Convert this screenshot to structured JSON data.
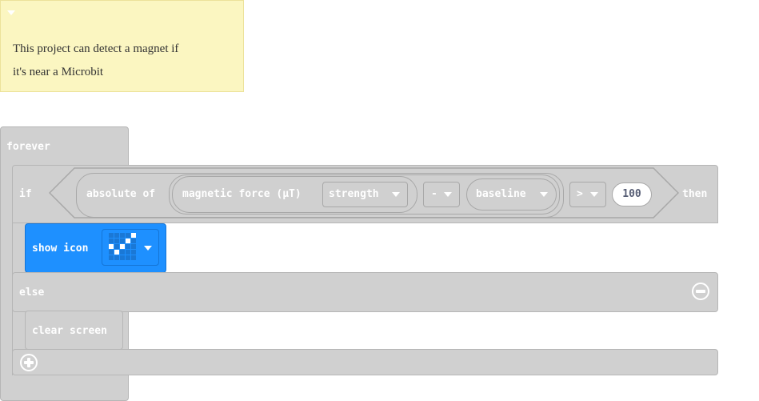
{
  "comment": {
    "lines": [
      "This project can detect a magnet if",
      "it's near a Microbit"
    ]
  },
  "blocks": {
    "forever": "forever",
    "if": "if",
    "then": "then",
    "else": "else",
    "absolute_of": "absolute of",
    "magnetic_force": "magnetic force (µT)",
    "axis_dropdown": "strength",
    "operator_dropdown": "-",
    "variable_dropdown": "baseline",
    "compare_dropdown": ">",
    "threshold_value": "100",
    "show_icon": "show icon",
    "clear_screen": "clear screen"
  },
  "icon_leds": [
    [
      0,
      0,
      0,
      0,
      1
    ],
    [
      0,
      0,
      0,
      1,
      0
    ],
    [
      1,
      0,
      1,
      0,
      0
    ],
    [
      0,
      1,
      0,
      0,
      0
    ],
    [
      0,
      0,
      0,
      0,
      0
    ]
  ],
  "colors": {
    "logic_gray": "#d0d0d0",
    "basic_blue": "#1e90ff",
    "note_yellow": "#fbf6c1"
  }
}
